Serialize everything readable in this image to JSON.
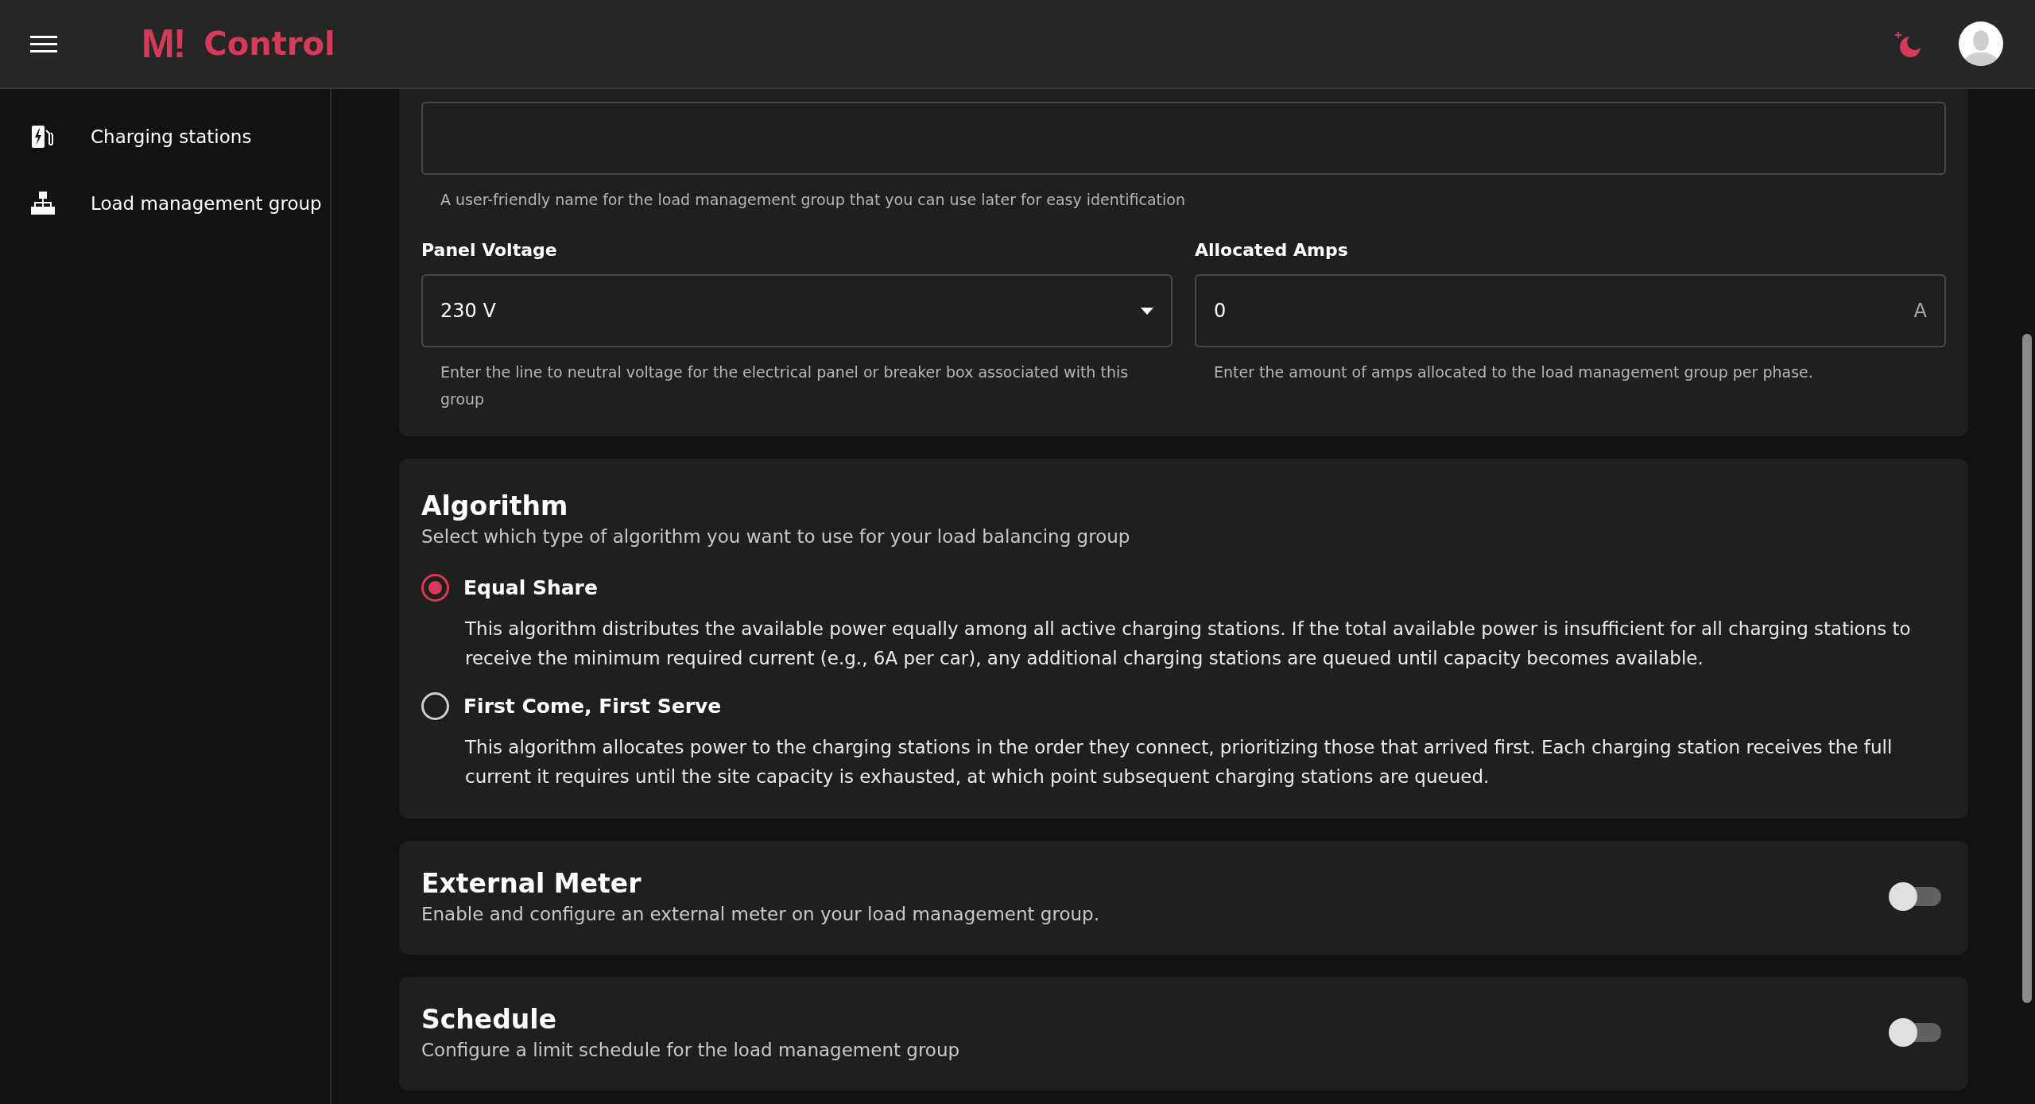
{
  "header": {
    "logo_mark": "M!",
    "title": "Control"
  },
  "sidebar": {
    "items": [
      {
        "kind": "charger",
        "label": "Charging stations"
      },
      {
        "kind": "hierarchy",
        "label": "Load management group"
      }
    ]
  },
  "general": {
    "name_field": {
      "helper": "A user-friendly name for the load management group that you can use later for easy identification"
    },
    "panel_voltage": {
      "label": "Panel Voltage",
      "value": "230 V",
      "helper": "Enter the line to neutral voltage for the electrical panel or breaker box associated with this group"
    },
    "allocated_amps": {
      "label": "Allocated Amps",
      "value": "0",
      "unit": "A",
      "helper": "Enter the amount of amps allocated to the load management group per phase."
    }
  },
  "algorithm": {
    "title": "Algorithm",
    "subtitle": "Select which type of algorithm you want to use for your load balancing group",
    "options": [
      {
        "label": "Equal Share",
        "selected": true,
        "description": "This algorithm distributes the available power equally among all active charging stations. If the total available power is insufficient for all charging stations to receive the minimum required current (e.g., 6A per car), any additional charging stations are queued until capacity becomes available."
      },
      {
        "label": "First Come, First Serve",
        "selected": false,
        "description": "This algorithm allocates power to the charging stations in the order they connect, prioritizing those that arrived first. Each charging station receives the full current it requires until the site capacity is exhausted, at which point subsequent charging stations are queued."
      }
    ]
  },
  "toggle_sections": [
    {
      "title": "External Meter",
      "subtitle": "Enable and configure an external meter on your load management group.",
      "on": false
    },
    {
      "title": "Schedule",
      "subtitle": "Configure a limit schedule for the load management group",
      "on": false
    }
  ]
}
